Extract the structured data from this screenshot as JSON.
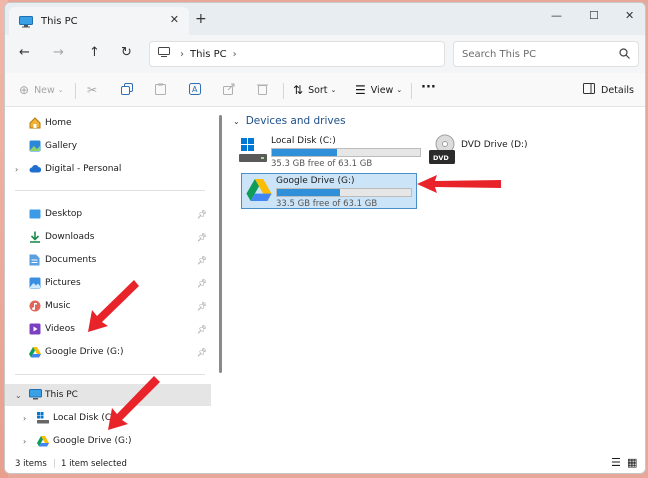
{
  "window": {
    "tab_title": "This PC",
    "tab_close": "✕",
    "new_tab": "+",
    "minimize": "—",
    "maximize": "☐",
    "close": "✕"
  },
  "nav": {
    "back": "←",
    "forward": "→",
    "up": "↑",
    "refresh": "↻",
    "breadcrumb": [
      "This PC"
    ],
    "sep": "›",
    "search_placeholder": "Search This PC"
  },
  "commands": {
    "new": "New",
    "sort": "Sort",
    "view": "View",
    "more": "···",
    "details": "Details"
  },
  "sidebar": {
    "quick": [
      {
        "label": "Home"
      },
      {
        "label": "Gallery"
      },
      {
        "label": "Digital - Personal"
      }
    ],
    "pinned": [
      {
        "label": "Desktop"
      },
      {
        "label": "Downloads"
      },
      {
        "label": "Documents"
      },
      {
        "label": "Pictures"
      },
      {
        "label": "Music"
      },
      {
        "label": "Videos"
      },
      {
        "label": "Google Drive (G:)"
      }
    ],
    "this_pc": "This PC",
    "drives": [
      {
        "label": "Local Disk (C:)"
      },
      {
        "label": "Google Drive (G:)"
      }
    ]
  },
  "content": {
    "group_title": "Devices and drives",
    "drives": [
      {
        "name": "Local Disk (C:)",
        "free": "35.3 GB free of 63.1 GB",
        "used_fraction": 0.44
      },
      {
        "name": "Google Drive (G:)",
        "free": "33.5 GB free of 63.1 GB",
        "used_fraction": 0.47
      }
    ],
    "dvd": {
      "name": "DVD Drive (D:)",
      "badge": "DVD"
    }
  },
  "status": {
    "count": "3 items",
    "selected": "1 item selected"
  },
  "colors": {
    "accent": "#2f8fd8",
    "selection": "#cce4f7",
    "arrow": "#e8232a"
  }
}
